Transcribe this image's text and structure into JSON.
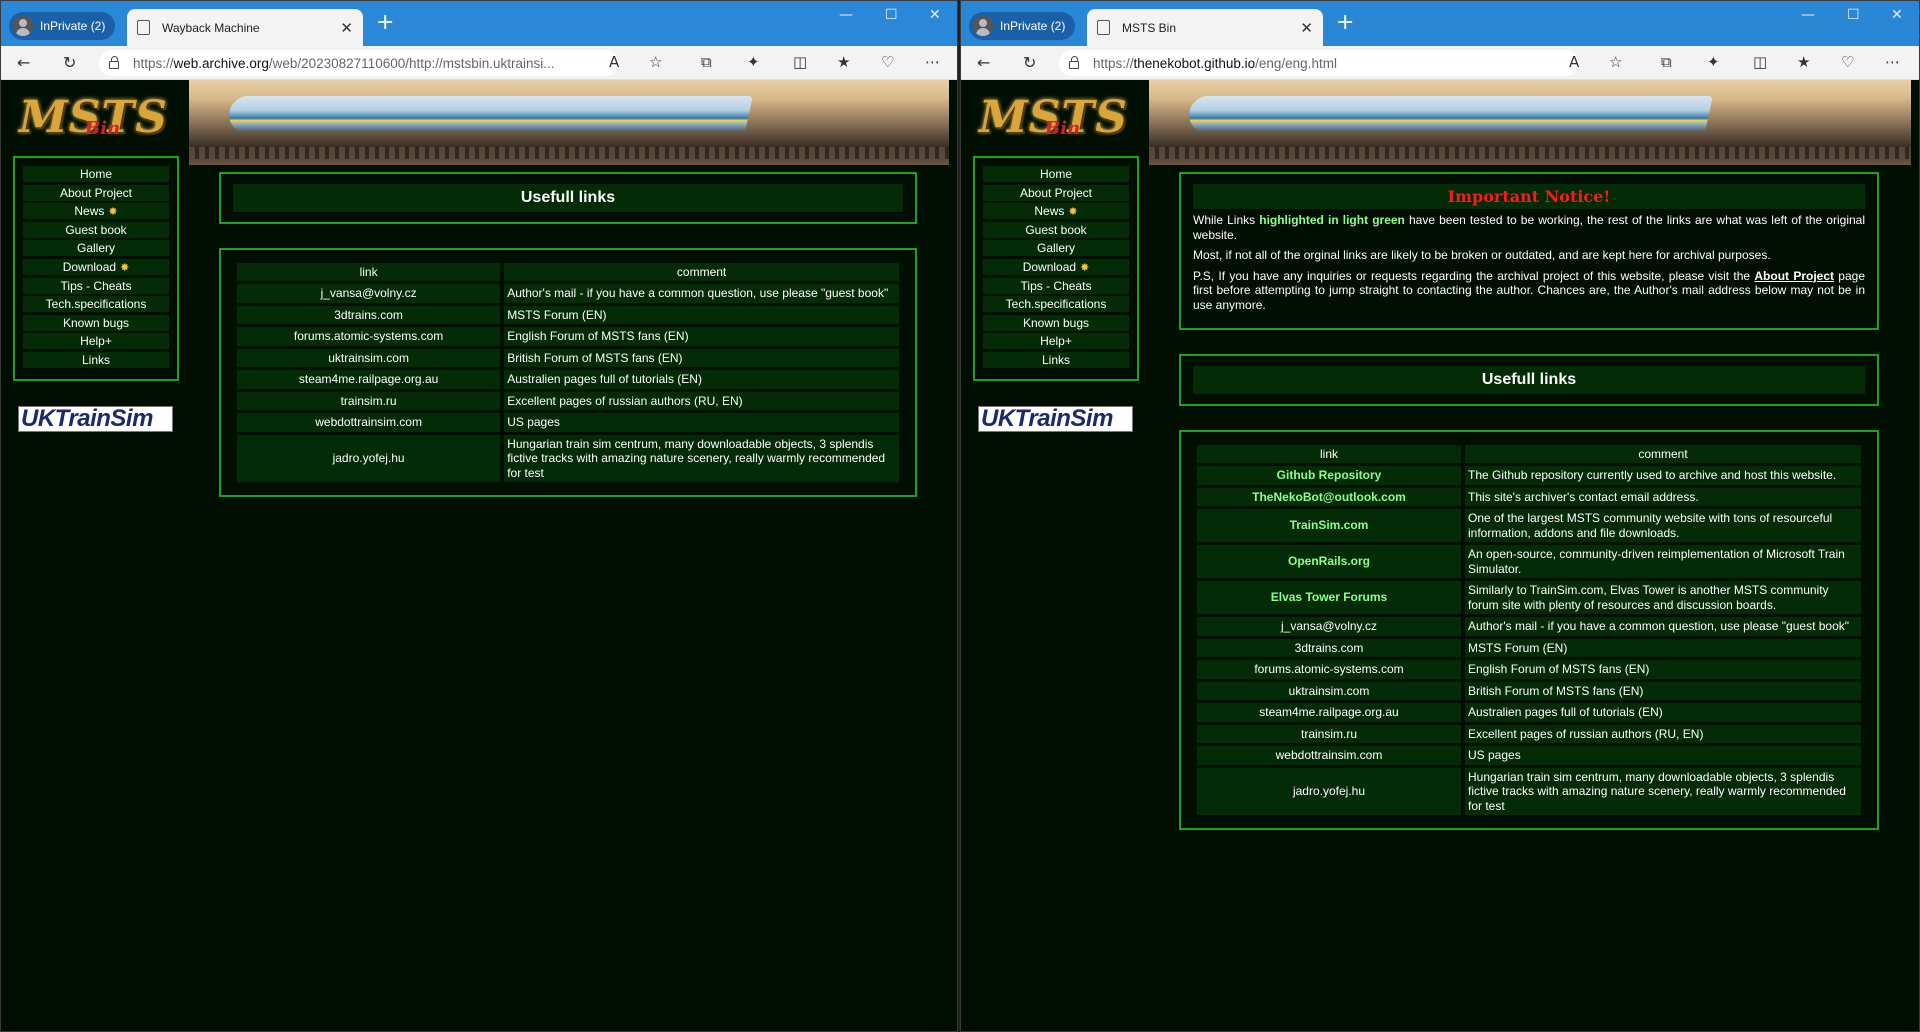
{
  "left": {
    "profile": "InPrivate (2)",
    "tab_title": "Wayback Machine",
    "url_prefix": "https://",
    "url_host": "web.archive.org",
    "url_rest": "/web/20230827110600/http://mstsbin.uktrainsi...",
    "logo_text": "MSTS",
    "logo_sub": "Bin",
    "menu": [
      "Home",
      "About Project",
      "News",
      "Guest book",
      "Gallery",
      "Download",
      "Tips - Cheats",
      "Tech.specifications",
      "Known bugs",
      "Help+",
      "Links"
    ],
    "uktrainsim": "UKTrainSim",
    "section_title": "Usefull links",
    "table": {
      "col_link": "link",
      "col_comment": "comment",
      "rows": [
        {
          "link": "j_vansa@volny.cz",
          "comment": "Author's mail - if you have a common question, use please \"guest book\""
        },
        {
          "link": "3dtrains.com",
          "comment": "MSTS Forum (EN)"
        },
        {
          "link": "forums.atomic-systems.com",
          "comment": "English Forum of MSTS fans (EN)"
        },
        {
          "link": "uktrainsim.com",
          "comment": "British Forum of MSTS fans (EN)"
        },
        {
          "link": "steam4me.railpage.org.au",
          "comment": "Australien pages full of tutorials (EN)"
        },
        {
          "link": "trainsim.ru",
          "comment": "Excellent pages of russian authors (RU, EN)"
        },
        {
          "link": "webdottrainsim.com",
          "comment": "US pages"
        },
        {
          "link": "jadro.yofej.hu",
          "comment": "Hungarian train sim centrum, many downloadable objects, 3 splendis fictive tracks with amazing nature scenery, really warmly recommended for test"
        }
      ]
    }
  },
  "right": {
    "profile": "InPrivate (2)",
    "tab_title": "MSTS Bin",
    "url_prefix": "https://",
    "url_host": "thenekobot.github.io",
    "url_rest": "/eng/eng.html",
    "logo_text": "MSTS",
    "logo_sub": "Bin",
    "menu": [
      "Home",
      "About Project",
      "News",
      "Guest book",
      "Gallery",
      "Download",
      "Tips - Cheats",
      "Tech.specifications",
      "Known bugs",
      "Help+",
      "Links"
    ],
    "uktrainsim": "UKTrainSim",
    "notice": {
      "title": "Important Notice!",
      "p1_a": "While Links ",
      "p1_hl": "highlighted in light green",
      "p1_b": " have been tested to be working, the rest of the links are what was left of the original website.",
      "p2": "Most, if not all of the orginal links are likely to be broken or outdated, and are kept here for archival purposes.",
      "p3_a": "P.S, If you have any inquiries or requests regarding the archival project of this website, please visit the ",
      "p3_link": "About Project",
      "p3_b": " page first before attempting to jump straight to contacting the author. Chances are, the Author's mail address below may not be in use anymore."
    },
    "section_title": "Usefull links",
    "table": {
      "col_link": "link",
      "col_comment": "comment",
      "rows": [
        {
          "link": "Github Repository",
          "comment": "The Github repository currently used to archive and host this website.",
          "green": true
        },
        {
          "link": "TheNekoBot@outlook.com",
          "comment": "This site's archiver's contact email address.",
          "green": true
        },
        {
          "link": "TrainSim.com",
          "comment": "One of the largest MSTS community website with tons of resourceful information, addons and file downloads.",
          "green": true
        },
        {
          "link": "OpenRails.org",
          "comment": "An open-source, community-driven reimplementation of Microsoft Train Simulator.",
          "green": true
        },
        {
          "link": "Elvas Tower Forums",
          "comment": "Similarly to TrainSim.com, Elvas Tower is another MSTS community forum site with plenty of resources and discussion boards.",
          "green": true
        },
        {
          "link": "j_vansa@volny.cz",
          "comment": "Author's mail - if you have a common question, use please \"guest book\""
        },
        {
          "link": "3dtrains.com",
          "comment": "MSTS Forum (EN)"
        },
        {
          "link": "forums.atomic-systems.com",
          "comment": "English Forum of MSTS fans (EN)"
        },
        {
          "link": "uktrainsim.com",
          "comment": "British Forum of MSTS fans (EN)"
        },
        {
          "link": "steam4me.railpage.org.au",
          "comment": "Australien pages full of tutorials (EN)"
        },
        {
          "link": "trainsim.ru",
          "comment": "Excellent pages of russian authors (RU, EN)"
        },
        {
          "link": "webdottrainsim.com",
          "comment": "US pages"
        },
        {
          "link": "jadro.yofej.hu",
          "comment": "Hungarian train sim centrum, many downloadable objects, 3 splendis fictive tracks with amazing nature scenery, really warmly recommended for test"
        }
      ]
    }
  }
}
